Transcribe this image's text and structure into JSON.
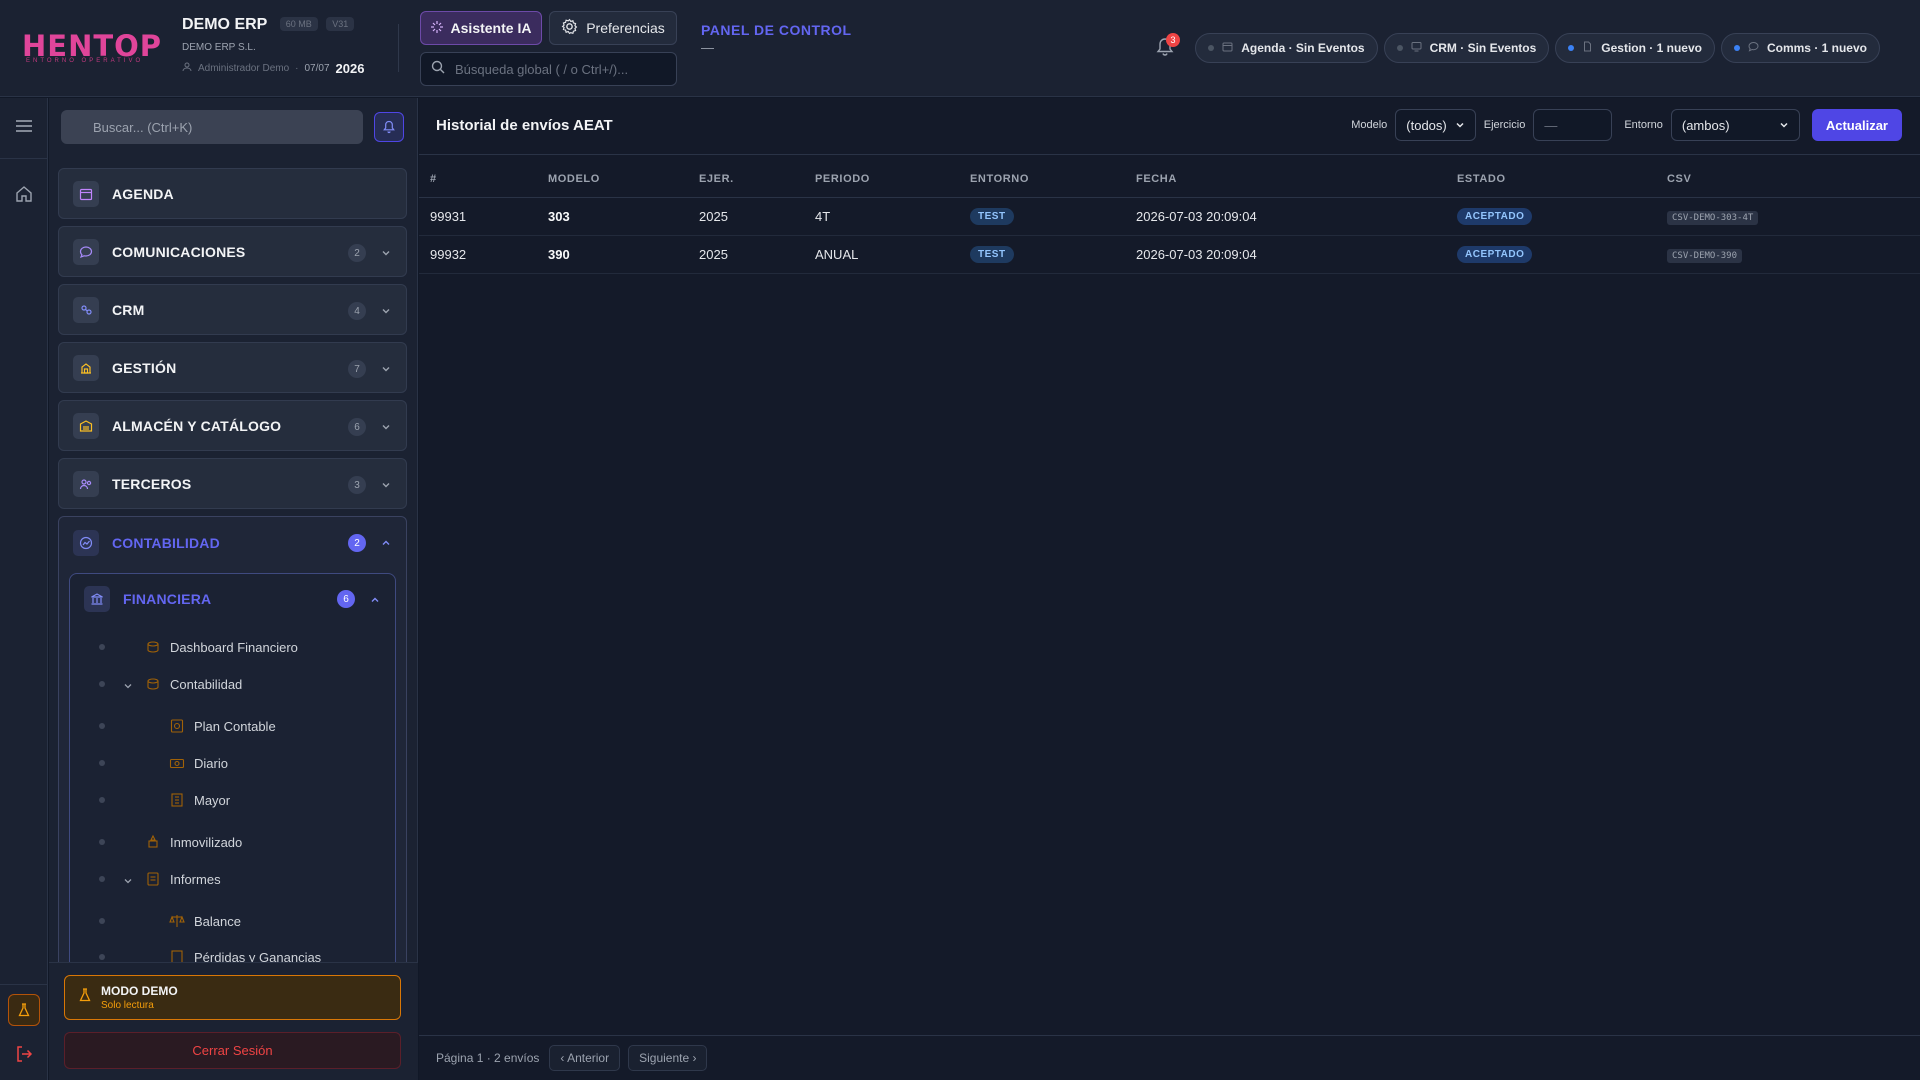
{
  "brand": {
    "logo_text": "HENTOP",
    "logo_sub": "ENTORNO OPERATIVO"
  },
  "app": {
    "name": "DEMO ERP",
    "size_badge": "60 MB",
    "version_badge": "V31",
    "company": "DEMO ERP S.L.",
    "user": "Administrador Demo",
    "date": "07/07",
    "year": "2026"
  },
  "toolbar": {
    "assistant_label": "Asistente IA",
    "preferences_label": "Preferencias",
    "search_placeholder": "Búsqueda global ( / o Ctrl+/)..."
  },
  "panel": {
    "title": "PANEL DE CONTROL",
    "subtitle": "—"
  },
  "notifications": {
    "count": "3"
  },
  "status_chips": [
    {
      "label": "Agenda · Sin Eventos",
      "active": false,
      "icon": "calendar-icon"
    },
    {
      "label": "CRM · Sin Eventos",
      "active": false,
      "icon": "monitor-icon"
    },
    {
      "label": "Gestion · 1 nuevo",
      "active": true,
      "icon": "document-icon"
    },
    {
      "label": "Comms · 1 nuevo",
      "active": true,
      "icon": "chat-icon"
    }
  ],
  "sidebar": {
    "search_placeholder": "Buscar... (Ctrl+K)",
    "sections": [
      {
        "label": "AGENDA",
        "count": ""
      },
      {
        "label": "COMUNICACIONES",
        "count": "2"
      },
      {
        "label": "CRM",
        "count": "4"
      },
      {
        "label": "GESTIÓN",
        "count": "7"
      },
      {
        "label": "ALMACÉN Y CATÁLOGO",
        "count": "6"
      },
      {
        "label": "TERCEROS",
        "count": "3"
      }
    ],
    "open_section": {
      "label": "CONTABILIDAD",
      "count": "2"
    },
    "subsection": {
      "label": "FINANCIERA",
      "count": "6"
    },
    "tree": [
      {
        "label": "Dashboard Financiero"
      },
      {
        "label": "Contabilidad"
      },
      {
        "label": "Plan Contable"
      },
      {
        "label": "Diario"
      },
      {
        "label": "Mayor"
      },
      {
        "label": "Inmovilizado"
      },
      {
        "label": "Informes"
      },
      {
        "label": "Balance"
      },
      {
        "label": "Pérdidas y Ganancias"
      }
    ],
    "demo_title": "MODO DEMO",
    "demo_sub": "Solo lectura",
    "logout_label": "Cerrar Sesión"
  },
  "main": {
    "title": "Historial de envíos AEAT",
    "filters": {
      "modelo_label": "Modelo",
      "modelo_value": "(todos)",
      "ejercicio_label": "Ejercicio",
      "ejercicio_value": "—",
      "entorno_label": "Entorno",
      "entorno_value": "(ambos)",
      "update_label": "Actualizar"
    },
    "columns": [
      "#",
      "MODELO",
      "EJER.",
      "PERIODO",
      "ENTORNO",
      "FECHA",
      "ESTADO",
      "CSV"
    ],
    "rows": [
      {
        "id": "99931",
        "modelo": "303",
        "ejercicio": "2025",
        "periodo": "4T",
        "entorno": "TEST",
        "fecha": "2026-07-03 20:09:04",
        "estado": "ACEPTADO",
        "csv": "CSV-DEMO-303-4T"
      },
      {
        "id": "99932",
        "modelo": "390",
        "ejercicio": "2025",
        "periodo": "ANUAL",
        "entorno": "TEST",
        "fecha": "2026-07-03 20:09:04",
        "estado": "ACEPTADO",
        "csv": "CSV-DEMO-390"
      }
    ],
    "footer": {
      "page_info": "Página 1 · 2 envíos",
      "prev_label": "‹ Anterior",
      "next_label": "Siguiente ›"
    }
  },
  "colors": {
    "accent": "#6366f1",
    "primary_button": "#4f46e5",
    "danger": "#ef4444",
    "warning": "#f59e0b"
  }
}
